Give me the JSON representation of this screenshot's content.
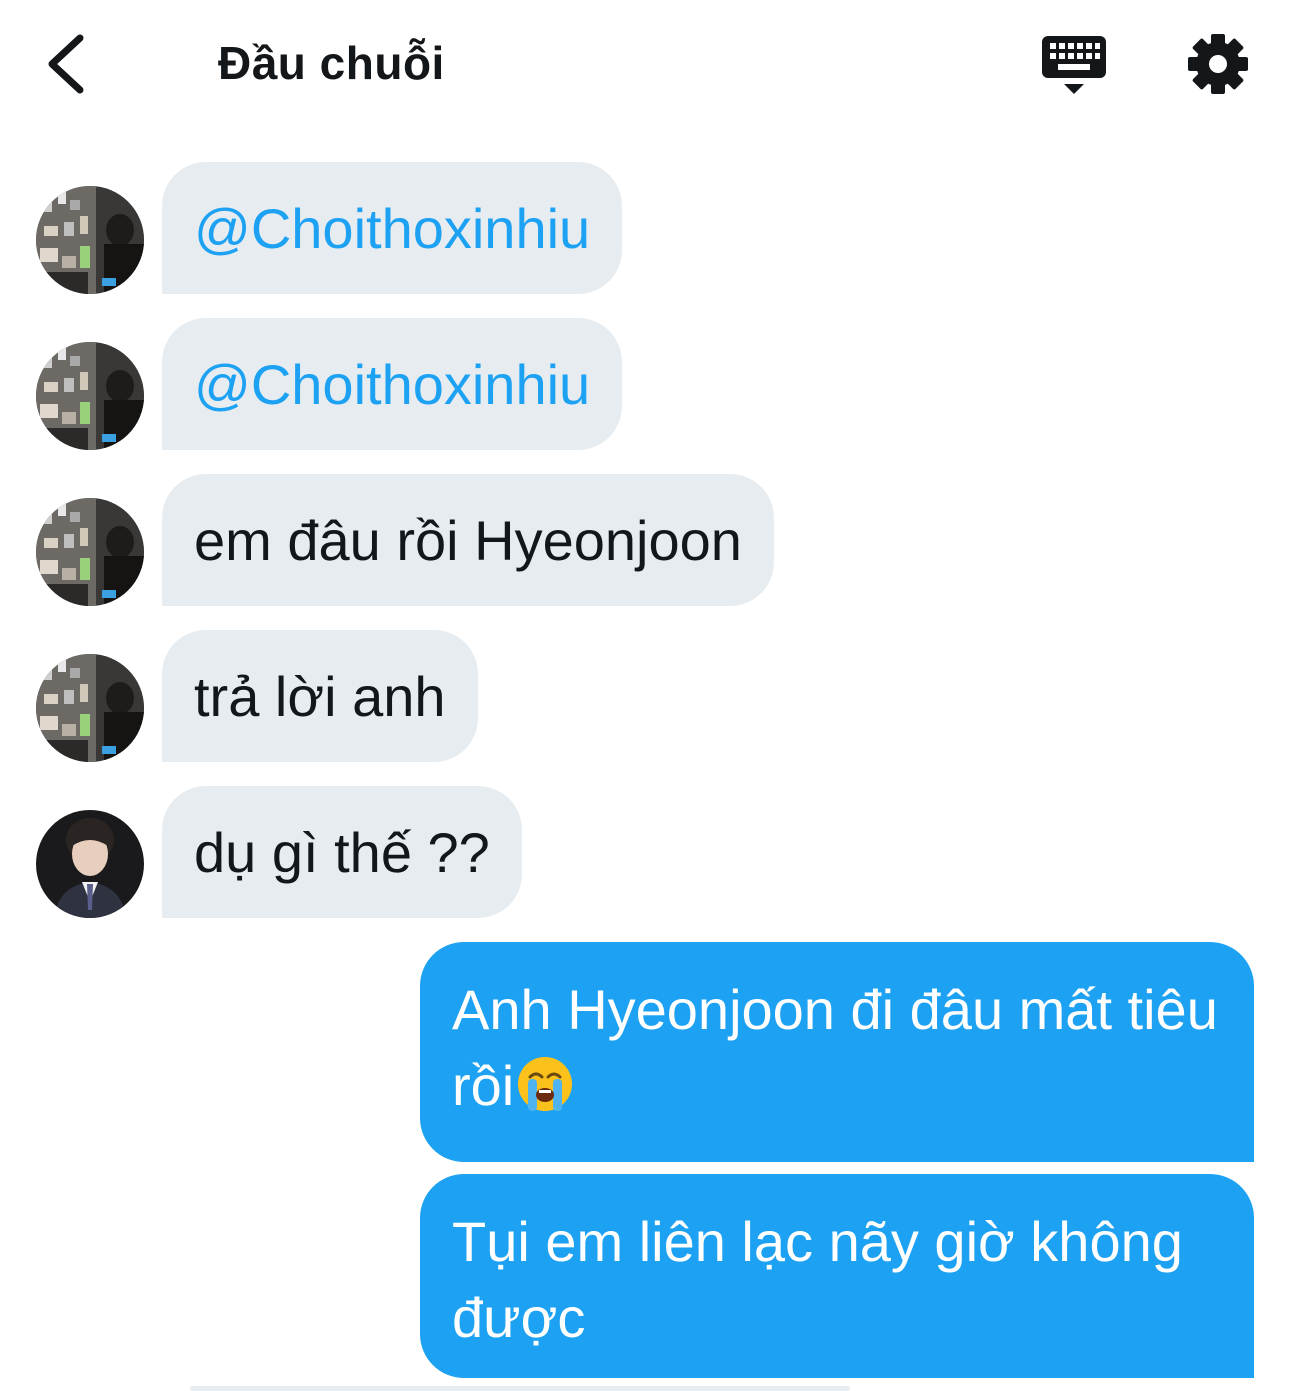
{
  "header": {
    "title": "Đầu chuỗi",
    "back_icon": "chevron-left-icon",
    "keyboard_icon": "keyboard-icon",
    "settings_icon": "gear-icon"
  },
  "colors": {
    "accent": "#1da1f2",
    "incoming_bubble": "#e6ecf0",
    "text": "#14171a"
  },
  "messages": [
    {
      "direction": "incoming",
      "avatar": "avatar-room-photo",
      "text": "@Choithoxinhiu"
    },
    {
      "direction": "incoming",
      "avatar": "avatar-room-photo",
      "text": "@Choithoxinhiu"
    },
    {
      "direction": "incoming",
      "avatar": "avatar-room-photo",
      "text": "em đâu rồi Hyeonjoon"
    },
    {
      "direction": "incoming",
      "avatar": "avatar-room-photo",
      "text": "trả lời anh"
    },
    {
      "direction": "incoming",
      "avatar": "avatar-suit-portrait",
      "text": "dụ gì thế ??"
    },
    {
      "direction": "outgoing",
      "text": "Anh Hyeonjoon đi đâu mất tiêu rồi",
      "emoji": "loudly-crying-face-icon"
    },
    {
      "direction": "outgoing",
      "text": "Tụi em liên lạc nãy giờ không được"
    }
  ]
}
